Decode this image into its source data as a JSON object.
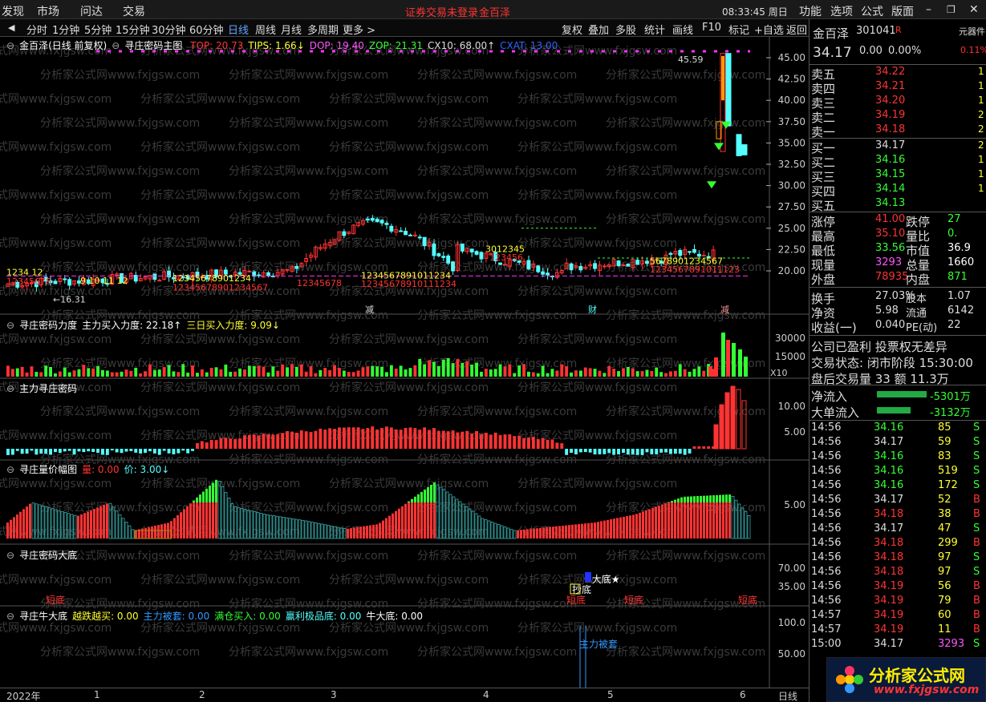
{
  "menubar": {
    "items": [
      "发现",
      "市场",
      "问达",
      "交易"
    ],
    "warning": "证券交易未登录",
    "stock_name": "金百泽",
    "time": "08:33:45 周日",
    "right_items": [
      "功能",
      "选项",
      "公式",
      "版面"
    ]
  },
  "toolbar": {
    "periods": [
      "分时",
      "1分钟",
      "5分钟",
      "15分钟",
      "30分钟",
      "60分钟",
      "日线",
      "周线",
      "月线",
      "多周期",
      "更多 >"
    ],
    "active_period": "日线",
    "right": [
      "复权",
      "叠加",
      "多股",
      "统计",
      "画线",
      "F10",
      "标记",
      "+自选",
      "返回"
    ]
  },
  "main_chart": {
    "title": "金百泽(日线 前复权)",
    "formula": "寻庄密码主图",
    "legend": [
      {
        "label": "TOP: 20.73",
        "color": "#ff3333"
      },
      {
        "label": "TIPS: 1.66↓",
        "color": "#ffff33"
      },
      {
        "label": "DOP: 19.40",
        "color": "#ff55ff"
      },
      {
        "label": "ZOP: 21.31",
        "color": "#33ff33"
      },
      {
        "label": "CX10: 68.00↑",
        "color": "#dddddd"
      },
      {
        "label": "CXAT: 13.00",
        "color": "#3366ff"
      }
    ],
    "high_label": "45.59",
    "low_label": "←16.31",
    "events": [
      "减",
      "财",
      "减"
    ],
    "yaxis": [
      "45.00",
      "42.50",
      "40.00",
      "37.50",
      "35.00",
      "32.50",
      "30.00",
      "27.50",
      "25.00",
      "22.50",
      "20.00"
    ]
  },
  "panel1": {
    "title": "寻庄密码力度",
    "legend": [
      {
        "label": "主力买入力度: 22.18↑",
        "color": "#ffffff"
      },
      {
        "label": "三日买入力度: 9.09↓",
        "color": "#ffff33"
      }
    ],
    "yaxis": [
      "30000",
      "15000"
    ],
    "unit": "X10"
  },
  "panel2": {
    "title": "主力寻庄密码",
    "yaxis": [
      "10.00",
      "5.00"
    ]
  },
  "panel3": {
    "title": "寻庄量价幅图",
    "legend": [
      {
        "label": "量: 0.00",
        "color": "#ff3333"
      },
      {
        "label": "价: 3.00↓",
        "color": "#55ffff"
      }
    ],
    "yaxis": [
      "5.00"
    ]
  },
  "panel4": {
    "title": "寻庄密码大底",
    "yaxis": [
      "70.00",
      "35.00"
    ],
    "labels": [
      "短底",
      "★大底★",
      "抄底",
      "短底",
      "短底",
      "短底"
    ]
  },
  "panel5": {
    "title": "寻庄牛大底",
    "legend": [
      {
        "label": "越跌越买: 0.00",
        "color": "#ffff33"
      },
      {
        "label": "主力被套: 0.00",
        "color": "#3399ff"
      },
      {
        "label": "满仓买入: 0.00",
        "color": "#33ff33"
      },
      {
        "label": "赢利极品底: 0.00",
        "color": "#55ffff"
      },
      {
        "label": "牛大底: 0.00",
        "color": "#ffffff"
      }
    ],
    "yaxis": [
      "100.0",
      "50.00"
    ],
    "marker": "主力被套"
  },
  "date_axis": {
    "labels": [
      "2022年",
      "1",
      "2",
      "3",
      "4",
      "5",
      "6"
    ],
    "period": "日线"
  },
  "quote": {
    "name": "金百泽",
    "code": "301041",
    "tag": "R",
    "price": "34.17",
    "change": "0.00",
    "pct": "0.00%",
    "right_tag": "元器件",
    "right_pct": "0.11%",
    "asks": [
      {
        "label": "卖五",
        "price": "34.22",
        "vol": "1"
      },
      {
        "label": "卖四",
        "price": "34.21",
        "vol": "1"
      },
      {
        "label": "卖三",
        "price": "34.20",
        "vol": "1"
      },
      {
        "label": "卖二",
        "price": "34.19",
        "vol": "2"
      },
      {
        "label": "卖一",
        "price": "34.18",
        "vol": "2"
      }
    ],
    "bids": [
      {
        "label": "买一",
        "price": "34.17",
        "vol": "2"
      },
      {
        "label": "买二",
        "price": "34.16",
        "vol": "1"
      },
      {
        "label": "买三",
        "price": "34.15",
        "vol": "1"
      },
      {
        "label": "买四",
        "price": "34.14",
        "vol": "1"
      },
      {
        "label": "买五",
        "price": "34.13",
        "vol": ""
      }
    ],
    "stats": [
      {
        "l1": "涨停",
        "v1": "41.00",
        "c1": "#ff3333",
        "l2": "跌停",
        "v2": "27",
        "c2": "#33ff33"
      },
      {
        "l1": "最高",
        "v1": "35.10",
        "c1": "#ff3333",
        "l2": "量比",
        "v2": "0.",
        "c2": "#33ff33"
      },
      {
        "l1": "最低",
        "v1": "33.56",
        "c1": "#33ff33",
        "l2": "市值",
        "v2": "36.9",
        "c2": "#ffffff"
      },
      {
        "l1": "现量",
        "v1": "3293",
        "c1": "#ff55ff",
        "l2": "总量",
        "v2": "1660",
        "c2": "#ffffff"
      },
      {
        "l1": "外盘",
        "v1": "78935",
        "c1": "#ff3333",
        "l2": "内盘",
        "v2": "871",
        "c2": "#33ff33"
      }
    ],
    "stats2": [
      {
        "l1": "换手",
        "v1": "27.03%",
        "l2": "股本",
        "v2": "1.07"
      },
      {
        "l1": "净资",
        "v1": "5.98",
        "l2": "流通",
        "v2": "6142"
      },
      {
        "l1": "收益(一)",
        "v1": "0.040",
        "l2": "PE(动)",
        "v2": "22"
      }
    ],
    "info": [
      "公司已盈利 投票权无差异",
      "交易状态: 闭市阶段 15:30:00",
      "盘后交易量 33 额 11.3万"
    ],
    "flows": [
      {
        "label": "净流入",
        "value": "-5301万"
      },
      {
        "label": "大单流入",
        "value": "-3132万"
      }
    ],
    "ticks": [
      {
        "t": "14:56",
        "p": "34.16",
        "v": "85",
        "s": "S"
      },
      {
        "t": "14:56",
        "p": "34.17",
        "v": "59",
        "s": "S"
      },
      {
        "t": "14:56",
        "p": "34.16",
        "v": "83",
        "s": "S"
      },
      {
        "t": "14:56",
        "p": "34.16",
        "v": "519",
        "s": "S"
      },
      {
        "t": "14:56",
        "p": "34.16",
        "v": "172",
        "s": "S"
      },
      {
        "t": "14:56",
        "p": "34.17",
        "v": "52",
        "s": "B"
      },
      {
        "t": "14:56",
        "p": "34.18",
        "v": "38",
        "s": "B"
      },
      {
        "t": "14:56",
        "p": "34.17",
        "v": "47",
        "s": "S"
      },
      {
        "t": "14:56",
        "p": "34.18",
        "v": "299",
        "s": "B"
      },
      {
        "t": "14:56",
        "p": "34.18",
        "v": "97",
        "s": "S"
      },
      {
        "t": "14:56",
        "p": "34.18",
        "v": "97",
        "s": "S"
      },
      {
        "t": "14:56",
        "p": "34.19",
        "v": "56",
        "s": "B"
      },
      {
        "t": "14:56",
        "p": "34.19",
        "v": "79",
        "s": "B"
      },
      {
        "t": "14:57",
        "p": "34.19",
        "v": "60",
        "s": "B"
      },
      {
        "t": "14:57",
        "p": "34.19",
        "v": "11",
        "s": "B"
      },
      {
        "t": "15:00",
        "p": "34.17",
        "v": "3293",
        "s": "S"
      }
    ]
  },
  "watermark": "分析家公式网www.fxjgsw.com",
  "logo": {
    "text": "分析家公式网",
    "url": "www.fxjgsw.com"
  },
  "colors": {
    "up": "#ff3333",
    "down": "#55ffff",
    "bg": "#000000"
  }
}
